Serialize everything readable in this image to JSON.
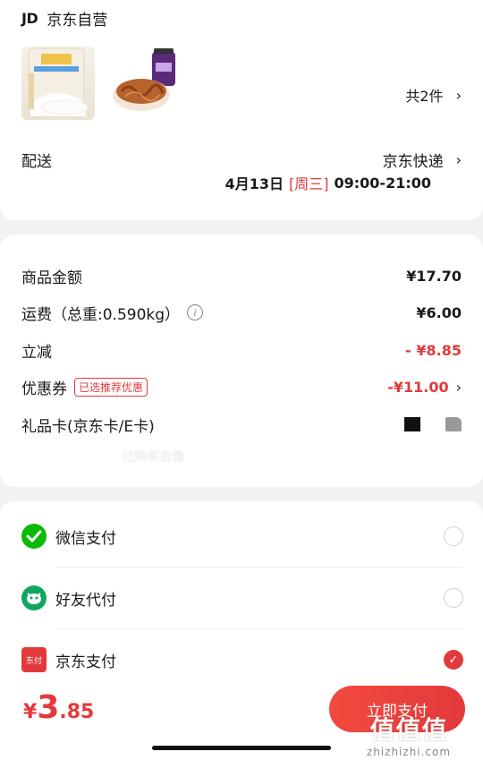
{
  "store": {
    "logo": "JD",
    "name": "京东自营",
    "products": [
      {
        "name": "salt-bag-product"
      },
      {
        "name": "pickled-vegetable-jar-product"
      }
    ],
    "count_label": "共2件"
  },
  "shipping": {
    "label": "配送",
    "method": "京东快递",
    "date": "4月13日",
    "weekday": "[周三]",
    "time": "09:00-21:00"
  },
  "price": {
    "rows": [
      {
        "label": "商品金额",
        "value": "¥17.70"
      },
      {
        "label": "运费（总重:0.590kg）",
        "value": "¥6.00"
      },
      {
        "label": "立减",
        "value": "- ¥8.85"
      },
      {
        "label": "优惠券",
        "tag": "已选推荐优惠",
        "value": "-¥11.00"
      },
      {
        "label": "礼品卡(京东卡/E卡)"
      }
    ],
    "blurred_text": "已购买去首"
  },
  "payment": {
    "methods": [
      {
        "label": "微信支付",
        "selected": false,
        "icon": "wechat-icon"
      },
      {
        "label": "好友代付",
        "selected": false,
        "icon": "friend-pay-icon"
      },
      {
        "label": "京东支付",
        "selected": true,
        "icon": "jd-pay-icon",
        "icon_text": "东付"
      }
    ]
  },
  "footer": {
    "currency": "¥",
    "total_int": "3",
    "total_dec": ".85",
    "pay_button": "立即支付"
  },
  "watermark": {
    "text": "值值值",
    "url": "zhizhizhi.com"
  },
  "colors": {
    "accent": "#e4393c",
    "wechat": "#09bb07",
    "background": "#f2f2f2"
  }
}
